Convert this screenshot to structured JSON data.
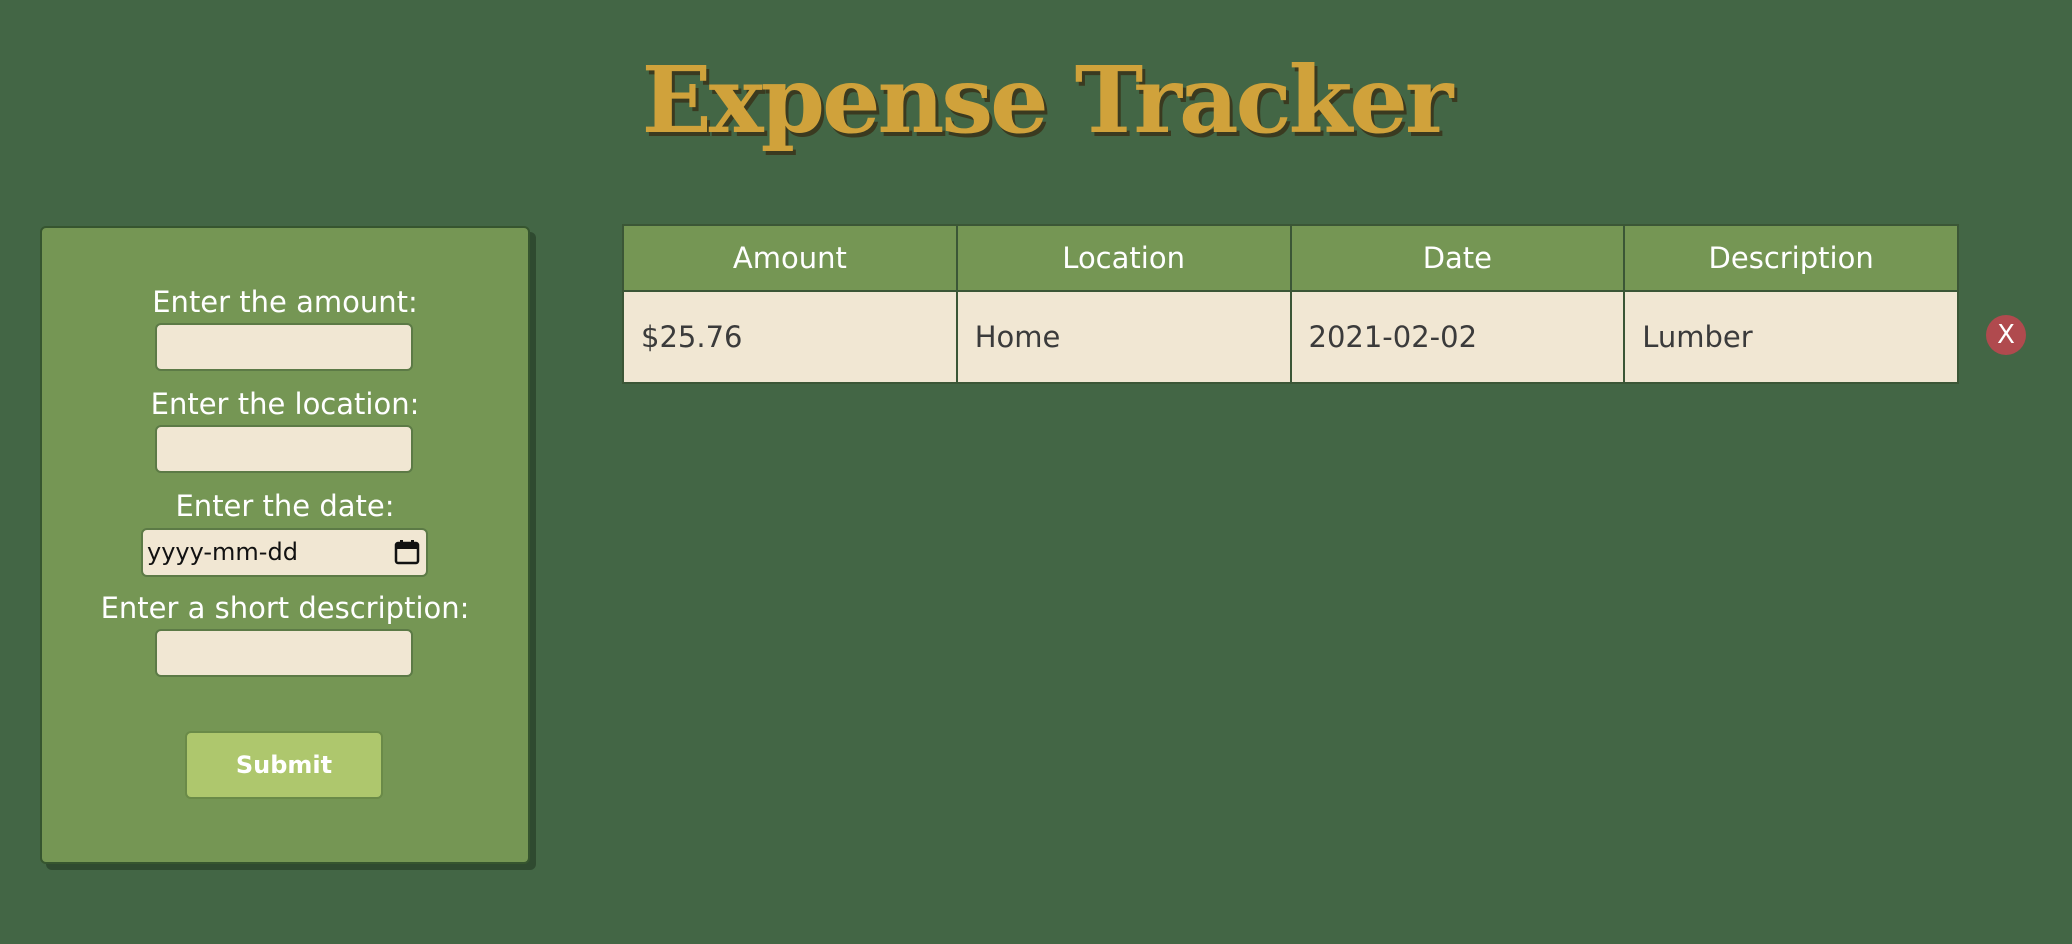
{
  "app": {
    "title": "Expense Tracker"
  },
  "form": {
    "amount_label": "Enter the amount:",
    "amount_value": "",
    "location_label": "Enter the location:",
    "location_value": "",
    "date_label": "Enter the date:",
    "date_placeholder": "yyyy-mm-dd",
    "description_label": "Enter a short description:",
    "description_value": "",
    "submit_label": "Submit"
  },
  "table": {
    "headers": [
      "Amount",
      "Location",
      "Date",
      "Description"
    ],
    "rows": [
      {
        "amount": "$25.76",
        "location": "Home",
        "date": "2021-02-02",
        "description": "Lumber",
        "delete_label": "X"
      }
    ]
  },
  "colors": {
    "background": "#436645",
    "panel": "#759654",
    "title": "#D0A23B",
    "input": "#F1E7D3",
    "submit": "#AEC76D",
    "delete": "#B04A4E"
  },
  "icons": {
    "date_picker": "calendar-icon"
  }
}
